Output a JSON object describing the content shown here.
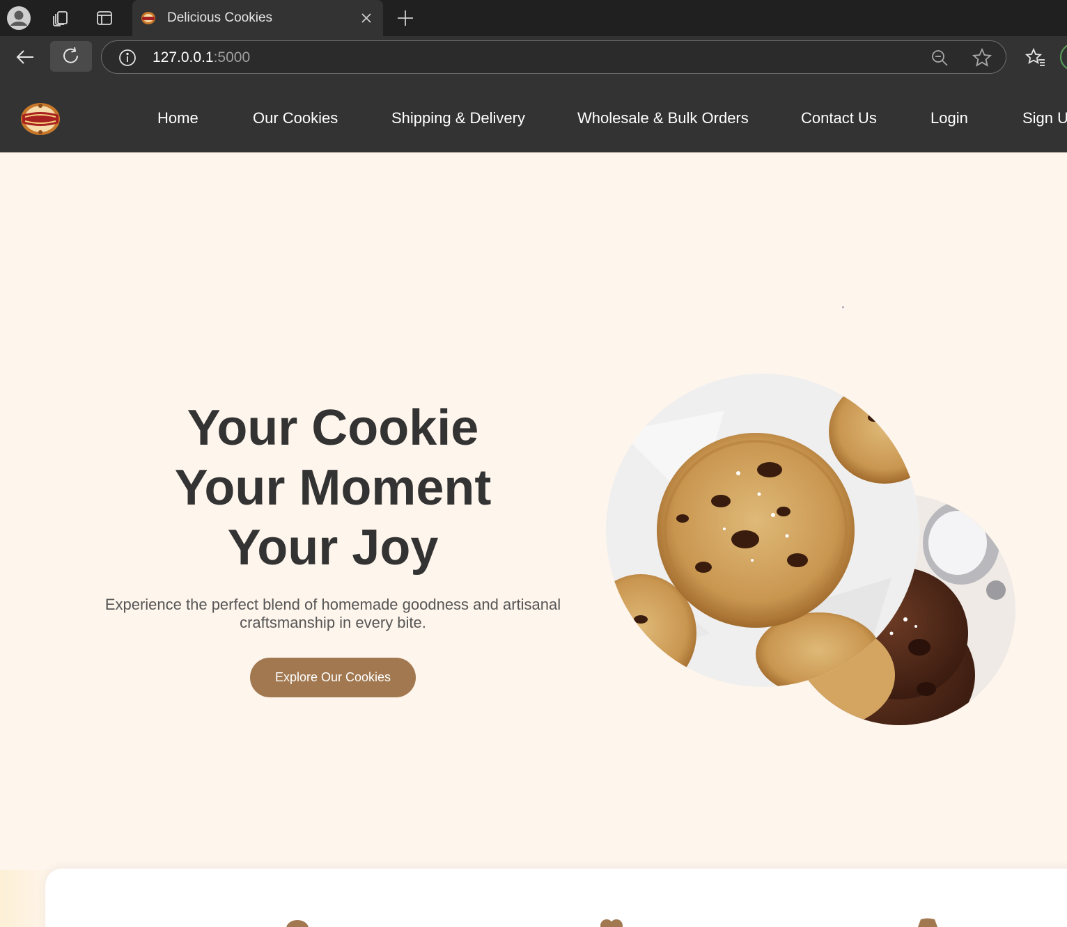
{
  "browser": {
    "tab_title": "Delicious Cookies",
    "url_host": "127.0.0.1",
    "url_port": ":5000"
  },
  "nav": {
    "items": [
      {
        "label": "Home"
      },
      {
        "label": "Our Cookies"
      },
      {
        "label": "Shipping & Delivery"
      },
      {
        "label": "Wholesale & Bulk Orders"
      },
      {
        "label": "Contact Us"
      },
      {
        "label": "Login"
      },
      {
        "label": "Sign Up"
      }
    ]
  },
  "hero": {
    "title_lines": [
      "Your Cookie",
      "Your Moment",
      "Your Joy"
    ],
    "subtitle": "Experience the perfect blend of homemade goodness and artisanal craftsmanship in every bite.",
    "cta_label": "Explore Our Cookies"
  },
  "colors": {
    "page_bg": "#fef5ec",
    "nav_bg": "#333333",
    "accent": "#a1784f",
    "heading": "#333333"
  },
  "icons": [
    "profile-icon",
    "collections-icon",
    "vertical-tabs-icon",
    "close-icon",
    "plus-icon",
    "back-arrow-icon",
    "reload-icon",
    "info-icon",
    "zoom-out-icon",
    "star-icon",
    "favorites-icon",
    "cookie-logo-icon"
  ]
}
